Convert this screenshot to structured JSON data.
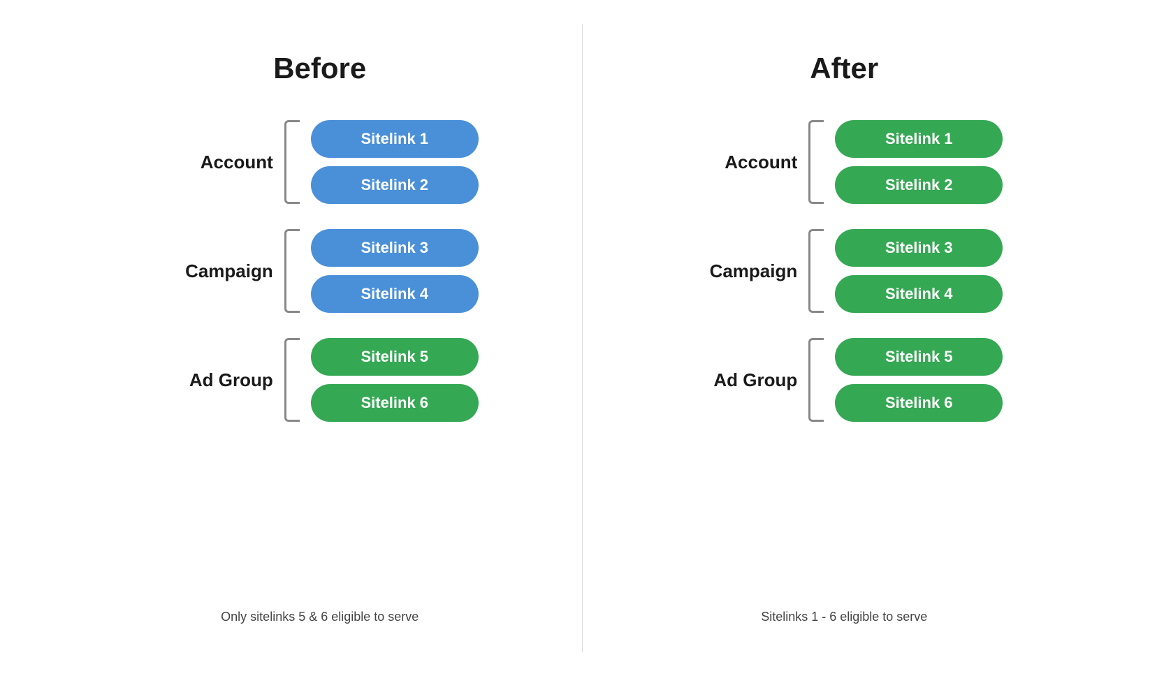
{
  "before": {
    "title": "Before",
    "levels": [
      {
        "label": "Account",
        "sitelinks": [
          {
            "text": "Sitelink 1",
            "color": "blue"
          },
          {
            "text": "Sitelink 2",
            "color": "blue"
          }
        ]
      },
      {
        "label": "Campaign",
        "sitelinks": [
          {
            "text": "Sitelink 3",
            "color": "blue"
          },
          {
            "text": "Sitelink 4",
            "color": "blue"
          }
        ]
      },
      {
        "label": "Ad Group",
        "sitelinks": [
          {
            "text": "Sitelink 5",
            "color": "green"
          },
          {
            "text": "Sitelink 6",
            "color": "green"
          }
        ]
      }
    ],
    "footnote": "Only sitelinks 5 & 6 eligible to serve"
  },
  "after": {
    "title": "After",
    "levels": [
      {
        "label": "Account",
        "sitelinks": [
          {
            "text": "Sitelink 1",
            "color": "green"
          },
          {
            "text": "Sitelink 2",
            "color": "green"
          }
        ]
      },
      {
        "label": "Campaign",
        "sitelinks": [
          {
            "text": "Sitelink 3",
            "color": "green"
          },
          {
            "text": "Sitelink 4",
            "color": "green"
          }
        ]
      },
      {
        "label": "Ad Group",
        "sitelinks": [
          {
            "text": "Sitelink 5",
            "color": "green"
          },
          {
            "text": "Sitelink 6",
            "color": "green"
          }
        ]
      }
    ],
    "footnote": "Sitelinks 1 - 6 eligible to serve"
  },
  "colors": {
    "blue": "#4A90D9",
    "green": "#34A853"
  }
}
